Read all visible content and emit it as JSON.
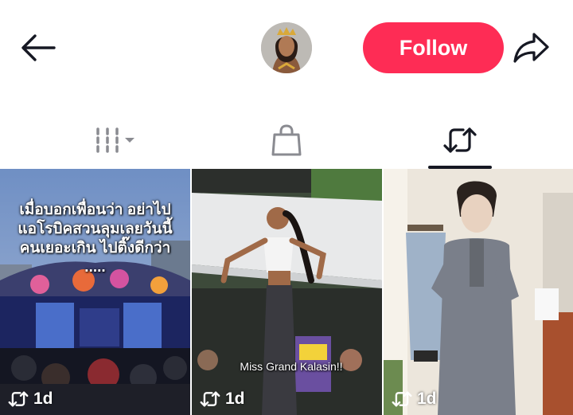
{
  "header": {
    "back_icon": "arrow-left-icon",
    "follow_label": "Follow",
    "share_icon": "share-arrow-icon"
  },
  "colors": {
    "follow_bg": "#fe2c55",
    "icon_dark": "#161823",
    "icon_muted": "#8a8b91"
  },
  "tabs": [
    {
      "name": "videos",
      "icon": "grid-bars-icon",
      "selected": false
    },
    {
      "name": "shop",
      "icon": "shopping-bag-icon",
      "selected": false
    },
    {
      "name": "reposts",
      "icon": "repost-icon",
      "selected": true
    }
  ],
  "videos": [
    {
      "caption": "เมื่อบอกเพื่อนว่า อย่าไป แอโรบิคสวนลุมเลยวันนี้ คนเยอะเกิน ไปติ๊งดีกว่า .....",
      "age": "1d",
      "badge_icon": "repost-icon"
    },
    {
      "caption": "Miss Grand Kalasin!!",
      "age": "1d",
      "badge_icon": "repost-icon"
    },
    {
      "caption": "",
      "age": "1d",
      "badge_icon": "repost-icon"
    }
  ]
}
